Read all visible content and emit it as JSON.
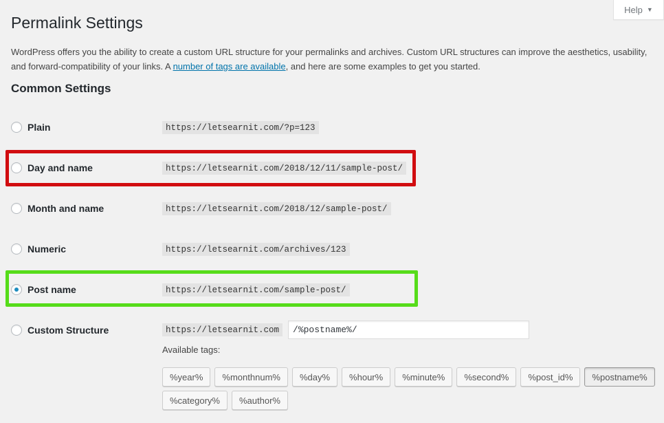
{
  "help": {
    "label": "Help",
    "caret": "▼"
  },
  "page_title": "Permalink Settings",
  "intro": {
    "before_link": "WordPress offers you the ability to create a custom URL structure for your permalinks and archives. Custom URL structures can improve the aesthetics, usability, and forward-compatibility of your links. A ",
    "link_text": "number of tags are available",
    "after_link": ", and here are some examples to get you started."
  },
  "section_title": "Common Settings",
  "options": [
    {
      "label": "Plain",
      "example": "https://letsearnit.com/?p=123",
      "checked": false
    },
    {
      "label": "Day and name",
      "example": "https://letsearnit.com/2018/12/11/sample-post/",
      "checked": false,
      "highlight": "#d10d10"
    },
    {
      "label": "Month and name",
      "example": "https://letsearnit.com/2018/12/sample-post/",
      "checked": false
    },
    {
      "label": "Numeric",
      "example": "https://letsearnit.com/archives/123",
      "checked": false
    },
    {
      "label": "Post name",
      "example": "https://letsearnit.com/sample-post/",
      "checked": true,
      "highlight": "#56dc1a"
    },
    {
      "label": "Custom Structure",
      "example": "https://letsearnit.com",
      "checked": false,
      "input_value": "/%postname%/"
    }
  ],
  "available_tags_label": "Available tags:",
  "tags": [
    {
      "label": "%year%",
      "active": false
    },
    {
      "label": "%monthnum%",
      "active": false
    },
    {
      "label": "%day%",
      "active": false
    },
    {
      "label": "%hour%",
      "active": false
    },
    {
      "label": "%minute%",
      "active": false
    },
    {
      "label": "%second%",
      "active": false
    },
    {
      "label": "%post_id%",
      "active": false
    },
    {
      "label": "%postname%",
      "active": true
    },
    {
      "label": "%category%",
      "active": false
    },
    {
      "label": "%author%",
      "active": false
    }
  ],
  "colors": {
    "link": "#0073aa",
    "radio_checked": "#1e8cbe",
    "highlight_red": "#d10d10",
    "highlight_green": "#56dc1a"
  }
}
